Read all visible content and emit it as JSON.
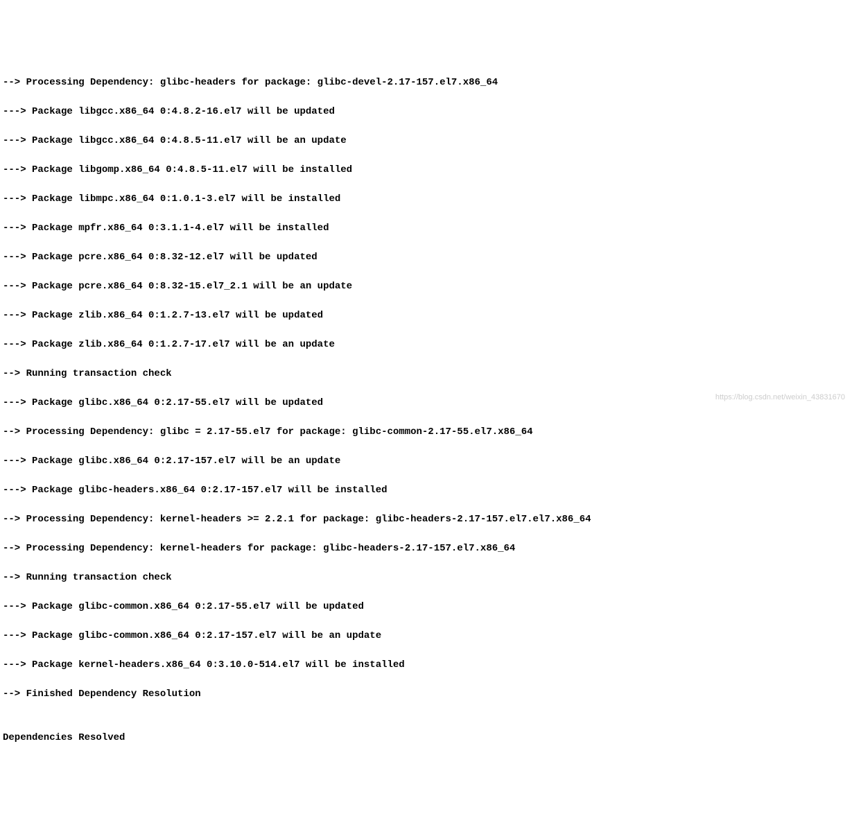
{
  "terminal": {
    "lines": [
      "--> Processing Dependency: glibc-headers for package: glibc-devel-2.17-157.el7.x86_64",
      "---> Package libgcc.x86_64 0:4.8.2-16.el7 will be updated",
      "---> Package libgcc.x86_64 0:4.8.5-11.el7 will be an update",
      "---> Package libgomp.x86_64 0:4.8.5-11.el7 will be installed",
      "---> Package libmpc.x86_64 0:1.0.1-3.el7 will be installed",
      "---> Package mpfr.x86_64 0:3.1.1-4.el7 will be installed",
      "---> Package pcre.x86_64 0:8.32-12.el7 will be updated",
      "---> Package pcre.x86_64 0:8.32-15.el7_2.1 will be an update",
      "---> Package zlib.x86_64 0:1.2.7-13.el7 will be updated",
      "---> Package zlib.x86_64 0:1.2.7-17.el7 will be an update",
      "--> Running transaction check",
      "---> Package glibc.x86_64 0:2.17-55.el7 will be updated",
      "--> Processing Dependency: glibc = 2.17-55.el7 for package: glibc-common-2.17-55.el7.x86_64",
      "---> Package glibc.x86_64 0:2.17-157.el7 will be an update",
      "---> Package glibc-headers.x86_64 0:2.17-157.el7 will be installed",
      "--> Processing Dependency: kernel-headers >= 2.2.1 for package: glibc-headers-2.17-157.el7.el7.x86_64",
      "--> Processing Dependency: kernel-headers for package: glibc-headers-2.17-157.el7.x86_64",
      "--> Running transaction check",
      "---> Package glibc-common.x86_64 0:2.17-55.el7 will be updated",
      "---> Package glibc-common.x86_64 0:2.17-157.el7 will be an update",
      "---> Package kernel-headers.x86_64 0:3.10.0-514.el7 will be installed",
      "--> Finished Dependency Resolution",
      "",
      "Dependencies Resolved"
    ]
  },
  "watermark": {
    "text": "https://blog.csdn.net/weixin_43831670"
  }
}
